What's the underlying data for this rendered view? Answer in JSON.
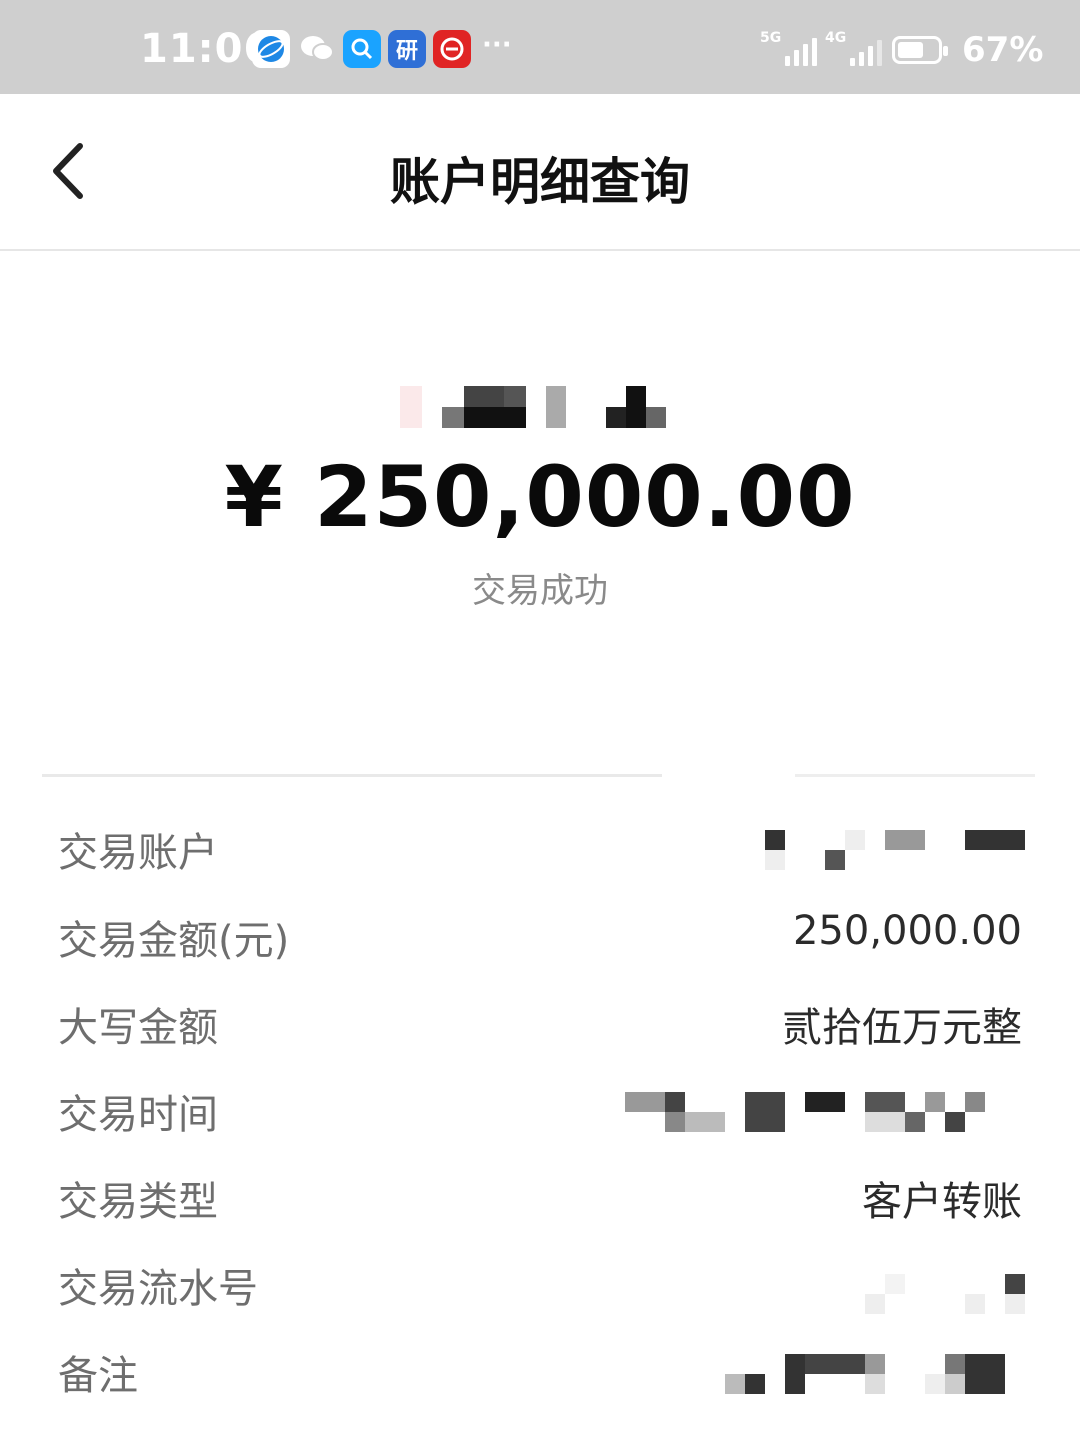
{
  "status_bar": {
    "time": "11:06",
    "more": "···",
    "network_1": "5G",
    "network_2": "4G",
    "battery": "67%",
    "battery_level": 0.67
  },
  "header": {
    "title": "账户明细查询"
  },
  "summary": {
    "amount": "¥ 250,000.00",
    "status": "交易成功"
  },
  "details": [
    {
      "label": "交易账户",
      "value": ""
    },
    {
      "label": "交易金额(元)",
      "value": "250,000.00"
    },
    {
      "label": "大写金额",
      "value": "贰拾伍万元整"
    },
    {
      "label": "交易时间",
      "value": ""
    },
    {
      "label": "交易类型",
      "value": "客户转账"
    },
    {
      "label": "交易流水号",
      "value": ""
    },
    {
      "label": "备注",
      "value": ""
    }
  ],
  "colors": {
    "status_bar_bg": "#cfcfcf",
    "title": "#111111",
    "label": "#6e6e6e",
    "value": "#2b2b2b",
    "icon_browser": "#1e88e5",
    "icon_search": "#1aa3ff",
    "icon_yan": "#2f6fd6",
    "icon_red": "#e02424"
  }
}
